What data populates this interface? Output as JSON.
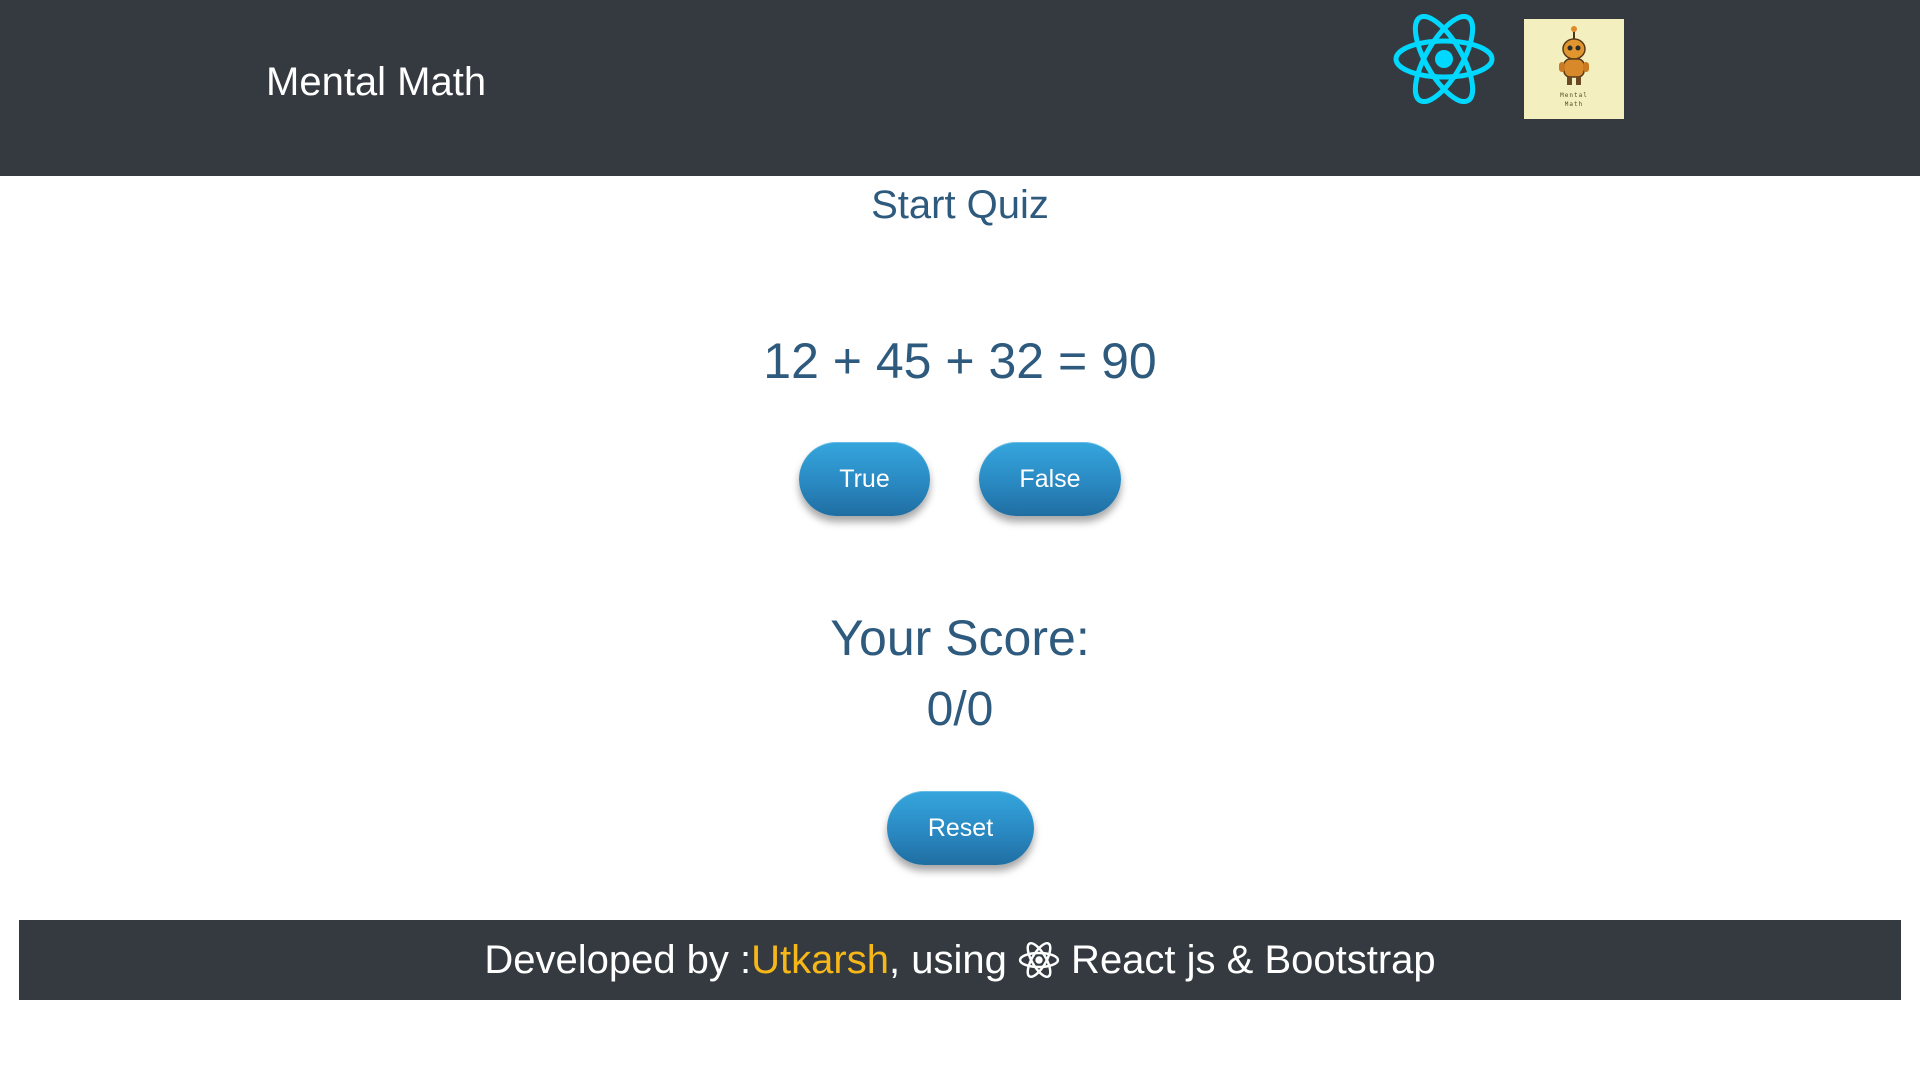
{
  "header": {
    "brand": "Mental Math",
    "react_logo_icon": "react-atom-icon",
    "app_logo_text_line1": "Mental",
    "app_logo_text_line2": "Math",
    "react_color": "#00d8ff"
  },
  "quiz": {
    "title": "Start Quiz",
    "question": "12 + 45 + 32 = 90",
    "true_label": "True",
    "false_label": "False",
    "score_label": "Your Score:",
    "score_value": "0/0",
    "reset_label": "Reset"
  },
  "footer": {
    "prefix": "Developed by :",
    "author": "Utkarsh",
    "middle": ", using ",
    "icon": "react-atom-icon",
    "suffix": " React js & Bootstrap",
    "author_color": "#f7b718"
  },
  "colors": {
    "navbar": "#343a40",
    "text": "#2e5a7e",
    "button": "#2a89c2"
  }
}
